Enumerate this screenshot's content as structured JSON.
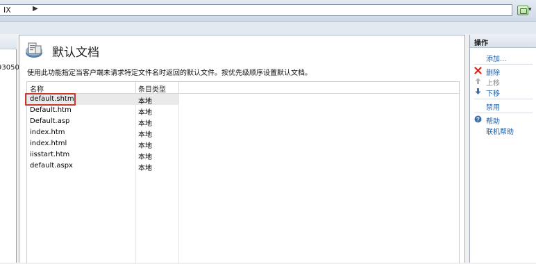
{
  "address_bar": {
    "path_fragment": "IX"
  },
  "left_pane": {
    "node_text": "93050"
  },
  "feature": {
    "title": "默认文档",
    "description": "使用此功能指定当客户端未请求特定文件名时返回的默认文件。按优先级顺序设置默认文档。",
    "icon": "default-document-icon"
  },
  "list": {
    "columns": [
      "名称",
      "条目类型"
    ],
    "rows": [
      {
        "name": "default.shtm",
        "type": "本地"
      },
      {
        "name": "Default.htm",
        "type": "本地"
      },
      {
        "name": "Default.asp",
        "type": "本地"
      },
      {
        "name": "index.htm",
        "type": "本地"
      },
      {
        "name": "index.html",
        "type": "本地"
      },
      {
        "name": "iisstart.htm",
        "type": "本地"
      },
      {
        "name": "default.aspx",
        "type": "本地"
      }
    ],
    "selected_index": 0
  },
  "actions": {
    "title": "操作",
    "add": "添加...",
    "remove": "删除",
    "move_up": "上移",
    "move_down": "下移",
    "disable": "禁用",
    "help": "帮助",
    "online_help": "联机帮助"
  },
  "colors": {
    "highlight": "#c8392b",
    "link": "#1f5fa8",
    "disabled": "#8a8a8a"
  }
}
